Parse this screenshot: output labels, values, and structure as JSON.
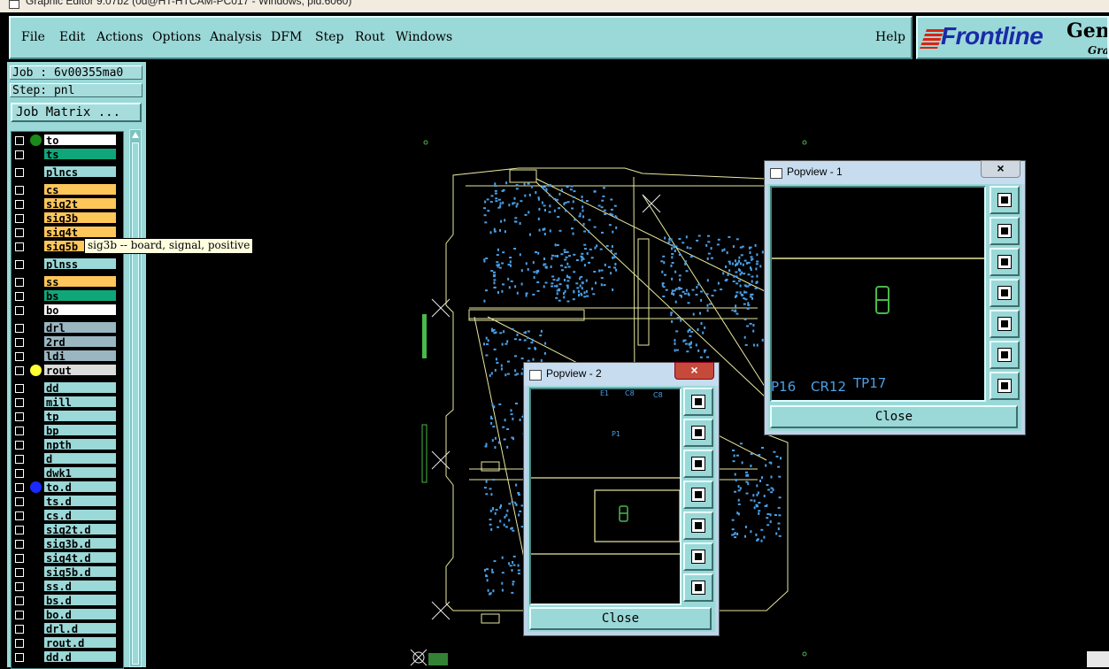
{
  "window_title": "Graphic Editor 9.07b2 (0d@HT-HTCAM-PC017 - Windows, pid:6060)",
  "menu": [
    "File",
    "Edit",
    "Actions",
    "Options",
    "Analysis",
    "DFM",
    "Step",
    "Rout",
    "Windows"
  ],
  "help_label": "Help",
  "brand": {
    "logo": "Frontline",
    "name": "Gene",
    "sub": "Grap"
  },
  "job": {
    "job_label": "Job : 6v00355ma0",
    "step_label": "Step: pnl",
    "matrix_button": "Job Matrix ..."
  },
  "layers": [
    {
      "name": "to",
      "color": "#ffffff",
      "dot": "#1a8a1a"
    },
    {
      "name": "ts",
      "color": "#0fa77a"
    },
    {
      "name": "plncs",
      "color": "#9bd8d8"
    },
    {
      "name": "cs",
      "color": "#ffc65a"
    },
    {
      "name": "sig2t",
      "color": "#ffc65a"
    },
    {
      "name": "sig3b",
      "color": "#ffc65a"
    },
    {
      "name": "sig4t",
      "color": "#ffc65a"
    },
    {
      "name": "sig5b",
      "color": "#ffc65a"
    },
    {
      "name": "plnss",
      "color": "#9bd8d8"
    },
    {
      "name": "ss",
      "color": "#ffc65a"
    },
    {
      "name": "bs",
      "color": "#0fa77a"
    },
    {
      "name": "bo",
      "color": "#ffffff"
    },
    {
      "name": "drl",
      "color": "#9ab6c0"
    },
    {
      "name": "2rd",
      "color": "#9ab6c0"
    },
    {
      "name": "ldi",
      "color": "#9ab6c0"
    },
    {
      "name": "rout",
      "color": "#dcdcdc",
      "dot": "#ffff33"
    },
    {
      "name": "dd",
      "color": "#9bd8d8"
    },
    {
      "name": "mill",
      "color": "#9bd8d8"
    },
    {
      "name": "tp",
      "color": "#9bd8d8"
    },
    {
      "name": "bp",
      "color": "#9bd8d8"
    },
    {
      "name": "npth",
      "color": "#9bd8d8"
    },
    {
      "name": "d",
      "color": "#9bd8d8"
    },
    {
      "name": "dwk1",
      "color": "#9bd8d8"
    },
    {
      "name": "to.d",
      "color": "#9bd8d8",
      "dot": "#1a2aff"
    },
    {
      "name": "ts.d",
      "color": "#9bd8d8"
    },
    {
      "name": "cs.d",
      "color": "#9bd8d8"
    },
    {
      "name": "sig2t.d",
      "color": "#9bd8d8"
    },
    {
      "name": "sig3b.d",
      "color": "#9bd8d8"
    },
    {
      "name": "sig4t.d",
      "color": "#9bd8d8"
    },
    {
      "name": "sig5b.d",
      "color": "#9bd8d8"
    },
    {
      "name": "ss.d",
      "color": "#9bd8d8"
    },
    {
      "name": "bs.d",
      "color": "#9bd8d8"
    },
    {
      "name": "bo.d",
      "color": "#9bd8d8"
    },
    {
      "name": "drl.d",
      "color": "#9bd8d8"
    },
    {
      "name": "rout.d",
      "color": "#9bd8d8"
    },
    {
      "name": "dd.d",
      "color": "#9bd8d8"
    }
  ],
  "tooltip": "sig3b -- board, signal, positive",
  "popview1": {
    "title": "Popview - 1",
    "labels": [
      "P16",
      "CR12",
      "TP17"
    ],
    "close": "Close"
  },
  "popview2": {
    "title": "Popview - 2",
    "labels": [
      "E1",
      "C8",
      "C8",
      "P1"
    ],
    "close": "Close"
  },
  "colors": {
    "panel": "#9bd8d8",
    "outline": "#e8e8a0",
    "pads": "#4aa0e8",
    "marker": "#4ab84a"
  }
}
